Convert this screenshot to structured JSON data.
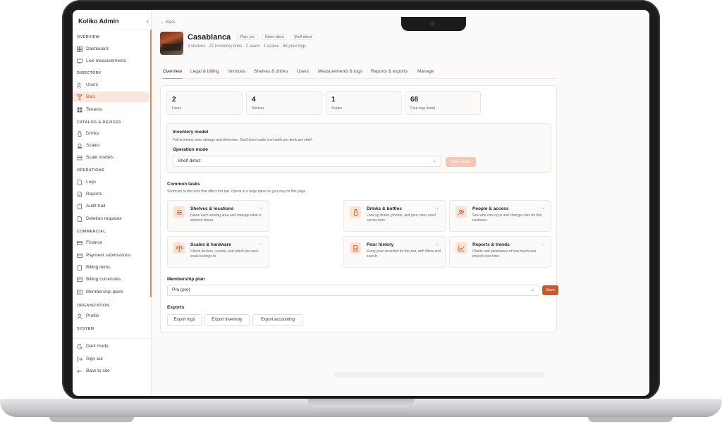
{
  "sidebar": {
    "brand": "Koliko Admin",
    "collapse": "‹",
    "sections": {
      "overview": "OVERVIEW",
      "directory": "DIRECTORY",
      "catalog": "CATALOG & DEVICES",
      "operations": "OPERATIONS",
      "commercial": "COMMERCIAL",
      "organization": "ORGANIZATION",
      "system": "SYSTEM"
    },
    "items": {
      "dashboard": "Dashboard",
      "live": "Live measurements",
      "users": "Users",
      "bars": "Bars",
      "tenants": "Tenants",
      "drinks": "Drinks",
      "scales": "Scales",
      "scale_models": "Scale models",
      "logs": "Logs",
      "reports": "Reports",
      "audit": "Audit trail",
      "deletion": "Deletion requests",
      "finance": "Finance",
      "payment": "Payment submissions",
      "billing_items": "Billing items",
      "billing_currencies": "Billing currencies",
      "membership": "Membership plans",
      "profile": "Profile"
    },
    "bottom": {
      "dark_mode": "Dark mode",
      "sign_out": "Sign out",
      "back_to_site": "Back to site"
    },
    "accent_color": "#e0875c"
  },
  "header": {
    "back": "← Bars",
    "title": "Casablanca",
    "chips": [
      "Plan: pro",
      "Direct client",
      "Shelf direct"
    ],
    "subline": "4 shelves · 27 inventory lines · 2 users · 1 scales · 68 pour logs"
  },
  "tabs": [
    "Overview",
    "Legal & billing",
    "Invoices",
    "Shelves & drinks",
    "Users",
    "Measurements & logs",
    "Reports & exports",
    "Manage"
  ],
  "stats": [
    {
      "value": "2",
      "label": "Users"
    },
    {
      "value": "4",
      "label": "Shelves"
    },
    {
      "value": "1",
      "label": "Scales"
    },
    {
      "value": "68",
      "label": "Pour logs (total)"
    }
  ],
  "inventory": {
    "title": "Inventory model",
    "desc": "Full inventory uses storage and deliveries. Shelf direct adds one bottle per drink per shelf.",
    "op_label": "Operation mode",
    "op_value": "Shelf direct",
    "save_mode": "Save mode"
  },
  "tasks_section": {
    "title": "Common tasks",
    "desc": "Shortcuts to the tools that affect this bar. Opens in a large panel so you stay on this page."
  },
  "tasks": [
    {
      "title": "Shelves & locations",
      "desc": "Name each serving area and manage what is stocked where.",
      "icon": "shelves-icon"
    },
    {
      "title": "Drinks & bottles",
      "desc": "Look up drinks, photos, and pour sizes used across bars.",
      "icon": "bottle-icon"
    },
    {
      "title": "People & access",
      "desc": "See who can log in and change roles for this customer.",
      "icon": "people-icon"
    },
    {
      "title": "Scales & hardware",
      "desc": "Check devices, rentals, and which bar each scale belongs to.",
      "icon": "scale-icon"
    },
    {
      "title": "Pour history",
      "desc": "Every pour recorded for this bar, with filters and search.",
      "icon": "document-icon"
    },
    {
      "title": "Reports & trends",
      "desc": "Charts and summaries of how much was poured over time.",
      "icon": "chart-icon"
    }
  ],
  "membership": {
    "title": "Membership plan",
    "value": "Pro (pro)",
    "save": "Save"
  },
  "exports": {
    "title": "Exports",
    "buttons": [
      "Export logs",
      "Export inventory",
      "Export accounting"
    ]
  },
  "colors": {
    "accent": "#e0875c",
    "primary_button": "#c85a2f",
    "active_bg": "#fbe6dd"
  }
}
